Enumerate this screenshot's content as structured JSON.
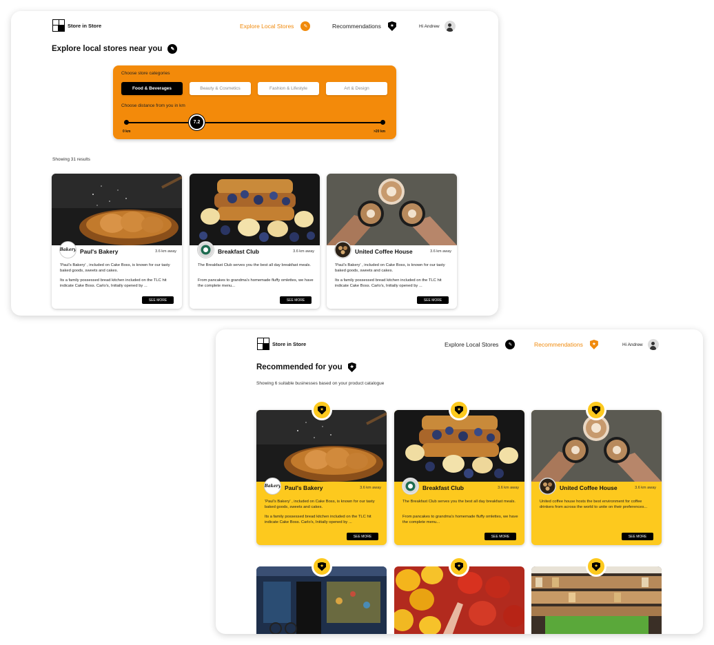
{
  "brand": {
    "name": "Store in Store"
  },
  "nav": {
    "explore_label": "Explore Local Stores",
    "recommendations_label": "Recommendations",
    "greeting": "Hi Andrew"
  },
  "screen1": {
    "title": "Explore local stores near you",
    "filters": {
      "categories_label": "Choose store categories",
      "categories": [
        "Food & Beverages",
        "Beauty & Cosmetics",
        "Fashion & Lifestyle",
        "Art & Design"
      ],
      "selected_category": "Food & Beverages",
      "distance_label": "Choose distance from you in km",
      "distance_value": "7.2",
      "distance_min": "0 km",
      "distance_max": ">20 km"
    },
    "results_text": "Showing 31 results",
    "cards": [
      {
        "name": "Paul's Bakery",
        "distance": "3.6 km away",
        "desc1": "'Paul's Bakery' , included on Cake Boss, is known for our tasty baked goods, sweets and cakes.",
        "desc2": "Its a family possessed bread kitchen included on the TLC hit indicate Cake Boss. Carlo's, Initially opened by ...",
        "button": "SEE MORE"
      },
      {
        "name": "Breakfast Club",
        "distance": "3.6 km away",
        "desc1": "The Breakfast Club serves you the best all day breakfast meals.",
        "desc2": "From pancakes to grandma's homemade fluffy omlettes, we have the complete menu...",
        "button": "SEE MORE"
      },
      {
        "name": "United Coffee House",
        "distance": "3.6 km away",
        "desc1": "'Paul's Bakery' , included on Cake Boss, is known for our tasty baked goods, sweets and cakes.",
        "desc2": "Its a family possessed bread kitchen included on the TLC hit indicate Cake Boss. Carlo's, Initially opened by ...",
        "button": "SEE MORE"
      }
    ]
  },
  "screen2": {
    "title": "Recommended for you",
    "subtitle": "Showing 6 suitable businesses based on your product catalogue",
    "cards": [
      {
        "name": "Paul's Bakery",
        "distance": "3.6 km away",
        "desc1": "'Paul's Bakery' , included on Cake Boss, is known for our tasty baked goods, sweets and cakes.",
        "desc2": "Its a family possessed bread kitchen included on the TLC hit indicate Cake Boss. Carlo's, Initially opened by ...",
        "button": "SEE MORE"
      },
      {
        "name": "Breakfast Club",
        "distance": "3.6 km away",
        "desc1": "The Breakfast Club serves you the best all day breakfast meals.",
        "desc2": "From pancakes to grandma's homemade fluffy omlettes, we have the complete menu...",
        "button": "SEE MORE"
      },
      {
        "name": "United Coffee House",
        "distance": "3.6 km away",
        "desc1": "United coffee house hosts the best environment for coffee drinkers from across the world to unite on their preferences...",
        "desc2": "",
        "button": "SEE MORE"
      }
    ]
  },
  "logos": {
    "bakery_text": "Bakery"
  },
  "colors": {
    "accent_orange": "#f08a0c",
    "card_yellow": "#fdc91e",
    "black": "#000000"
  },
  "icons": {
    "explore": "compass-icon",
    "recommendations": "badge-star-icon",
    "user": "user-icon"
  }
}
